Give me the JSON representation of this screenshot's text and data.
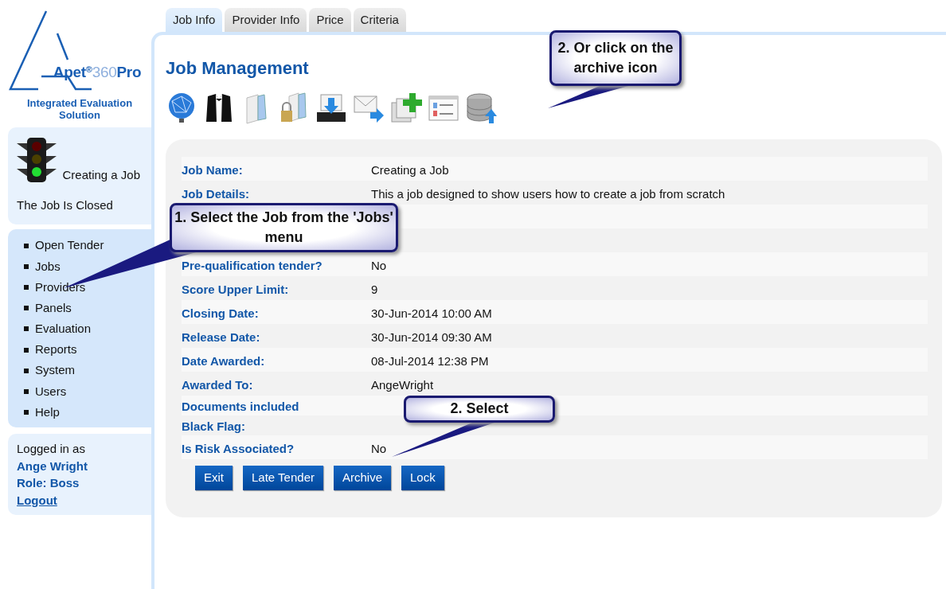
{
  "logo": {
    "name_1": "Apet",
    "mark": "®",
    "name_2": "360",
    "name_3": "Pro",
    "tagline": "Integrated Evaluation Solution"
  },
  "job_status": {
    "lamps": [
      {
        "lit": false
      },
      {
        "lit": false
      },
      {
        "lit": true
      }
    ],
    "job_name": "Creating a Job",
    "status": "The Job Is Closed"
  },
  "menu": [
    {
      "label": "Open Tender"
    },
    {
      "label": "Jobs"
    },
    {
      "label": "Providers"
    },
    {
      "label": "Panels"
    },
    {
      "label": "Evaluation"
    },
    {
      "label": "Reports"
    },
    {
      "label": "System"
    },
    {
      "label": "Users"
    },
    {
      "label": "Help"
    }
  ],
  "login": {
    "prefix": "Logged in as",
    "user": "Ange Wright",
    "role": "Role: Boss",
    "logout": "Logout"
  },
  "tabs": [
    {
      "label": "Job Info",
      "selected": true
    },
    {
      "label": "Provider Info",
      "selected": false
    },
    {
      "label": "Price",
      "selected": false
    },
    {
      "label": "Criteria",
      "selected": false
    }
  ],
  "title": "Job Management",
  "toolbar": [
    {
      "kind": "globe"
    },
    {
      "kind": "tuxedo"
    },
    {
      "kind": "folder"
    },
    {
      "kind": "locked-folder"
    },
    {
      "kind": "inbox"
    },
    {
      "kind": "mail-forward"
    },
    {
      "kind": "add-pages"
    },
    {
      "kind": "form"
    },
    {
      "kind": "database-upload"
    }
  ],
  "fields": [
    {
      "label": "Job Name:",
      "value": "Creating a Job"
    },
    {
      "label": "Job Details:",
      "value": "This a job designed to show users how to create a job from scratch"
    },
    {
      "kind": "covered"
    },
    {
      "kind": "covered"
    },
    {
      "label": "Pre-qualification tender?",
      "value": "No"
    },
    {
      "label": "Score Upper Limit:",
      "value": "9"
    },
    {
      "label": "Closing Date:",
      "value": "30-Jun-2014 10:00 AM"
    },
    {
      "label": "Release Date:",
      "value": "30-Jun-2014 09:30 AM"
    },
    {
      "label": "Date Awarded:",
      "value": "08-Jul-2014 12:38 PM"
    },
    {
      "label": "Awarded To:",
      "value": "AngeWright"
    },
    {
      "label": "Documents included",
      "kind": "short"
    },
    {
      "label": "Black Flag:",
      "kind": "short"
    },
    {
      "label": "Is Risk Associated?",
      "value": "No"
    }
  ],
  "buttons": [
    "Exit",
    "Late Tender",
    "Archive",
    "Lock"
  ],
  "callouts": [
    {
      "text": "2. Or click on the archive icon"
    },
    {
      "text": "1. Select the Job from the 'Jobs' menu"
    },
    {
      "text": "2. Select"
    }
  ]
}
